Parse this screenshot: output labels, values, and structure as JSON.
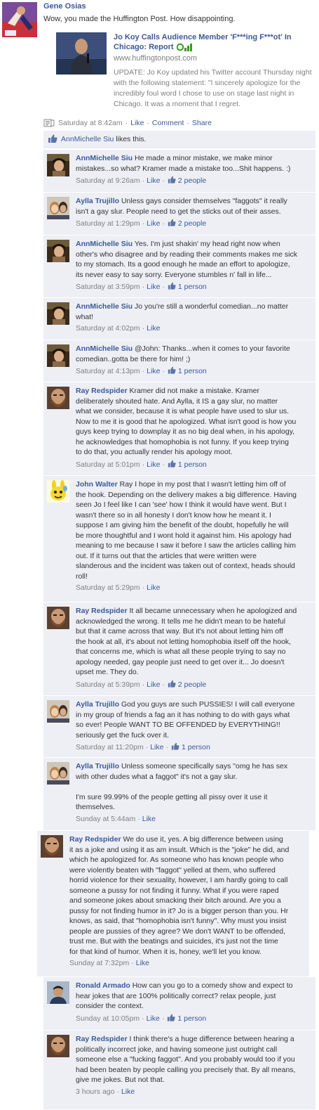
{
  "post": {
    "author": "Gene Osias",
    "message": "Wow, you made the Huffington Post. How disappointing.",
    "attachment": {
      "title_lines": [
        "Jo Koy Calls Audience Member 'F***ing F***ot' In",
        "Chicago: Report"
      ],
      "url": "www.huffingtonpost.com",
      "description_lines": [
        "UPDATE: Jo Koy updated his Twitter account Thursday night",
        "with the following statement: \"I sincerely apologize for the",
        "incredibly foul word I chose to use on stage last night in",
        "Chicago. It was a moment that I regret."
      ]
    },
    "meta": {
      "timestamp": "Saturday at 8:42am",
      "like": "Like",
      "comment": "Comment",
      "share": "Share"
    },
    "likes": {
      "who": "AnnMichelle Siu",
      "rest": "likes this."
    }
  },
  "comments": [
    {
      "name": "AnnMichelle Siu",
      "lines": [
        "He made a minor mistake, we make minor",
        "mistakes...so what? Kramer made a mistake too...Shit happens. :)"
      ],
      "time": "Saturday at 9:26am",
      "like": "Like",
      "likes_count": "2 people"
    },
    {
      "name": "Aylla Trujillo",
      "lines": [
        "Unless gays consider themselves \"faggots\" it really",
        "isn't a gay slur. People need to get the sticks out of their asses."
      ],
      "time": "Saturday at 1:29pm",
      "like": "Like",
      "likes_count": "2 people"
    },
    {
      "name": "AnnMichelle Siu",
      "lines": [
        "Yes. I'm just shakin' my head right now when",
        "other's who disagree and by reading their comments makes me sick",
        "to my stomach. Its a good enough he made an effort to apologize,",
        "its never easy to say sorry. Everyone stumbles n' fall in life..."
      ],
      "time": "Saturday at 3:59pm",
      "like": "Like",
      "likes_count": "1 person"
    },
    {
      "name": "AnnMichelle Siu",
      "lines": [
        "Jo you're still a wonderful comedian...no matter",
        "what!"
      ],
      "time": "Saturday at 4:02pm",
      "like": "Like",
      "likes_count": ""
    },
    {
      "name": "AnnMichelle Siu",
      "lines": [
        "@John: Thanks...when it comes to your favorite",
        "comedian..gotta be there for him! ;)"
      ],
      "time": "Saturday at 4:13pm",
      "like": "Like",
      "likes_count": "1 person"
    },
    {
      "name": "Ray Redspider",
      "lines": [
        "Kramer did not make a mistake. Kramer",
        "deliberately shouted hate. And Aylla, it IS a gay slur, no matter",
        "what we consider, because it is what people have used to slur us.",
        "Now to me it is good that he apologized. What isn't good is how you",
        "guys keep trying to downplay it as no big deal when, in his apology,",
        "he acknowledges that homophobia is not funny. If you keep trying",
        "to do that, you actually render his apology moot."
      ],
      "time": "Saturday at 5:01pm",
      "like": "Like",
      "likes_count": "1 person"
    },
    {
      "name": "John Walter",
      "lines": [
        "Ray I hope in my post that I wasn't letting him off of",
        "the hook. Depending on the delivery makes a big difference. Having",
        "seen Jo I feel like I can 'see' how I think it would have went. But I",
        "wasn't there so in all honesty I don't know how he meant it. I",
        "suppose I am giving him the benefit of the doubt, hopefully he will",
        "be more thoughtful and I wont hold it against him. His apology had",
        "meaning to me because I saw it before I saw the articles calling him",
        "out. If it turns out that the articles that were written were",
        "slanderous and the incident was taken out of context, heads should",
        "roll!"
      ],
      "time": "Saturday at 5:29pm",
      "like": "Like",
      "likes_count": ""
    },
    {
      "name": "Ray Redspider",
      "lines": [
        "It all became unnecessary when he apologized and",
        "acknowledged the wrong. It tells me he didn't mean to be hateful",
        "but that it came across that way. But it's not about letting him off",
        "the hook at all, it's about not letting homophobia itself off the hook,",
        "that concerns me, which is what all these people trying to say no",
        "apology needed, gay people just need to get over it... Jo doesn't",
        "upset me. They do."
      ],
      "time": "Saturday at 5:39pm",
      "like": "Like",
      "likes_count": "2 people"
    },
    {
      "name": "Aylla Trujillo",
      "lines": [
        "God you guys are such PUSSIES! I will call everyone",
        "in my group of friends a fag an it has nothing to do with gays what",
        "so ever! People WANT TO BE OFFENDED by EVERYTHING!!",
        "seriously get the fuck over it."
      ],
      "time": "Saturday at 11:20pm",
      "like": "Like",
      "likes_count": "1 person"
    },
    {
      "name": "Aylla Trujillo",
      "lines": [
        "Unless someone specifically says \"omg he has sex",
        "with other dudes what a faggot\" it's not a gay slur.",
        "",
        "I'm sure 99.99% of the people getting all pissy over it use it",
        "themselves."
      ],
      "time": "Sunday at 5:44am",
      "like": "Like",
      "likes_count": ""
    },
    {
      "name": "Ray Redspider",
      "lines": [
        "We do use it, yes. A big difference between using",
        "it as a joke and using it as am insult. Which is the \"joke\" he did, and",
        "which he apologized for. As someone who has known people who",
        "were violently beaten with \"faggot\" yelled at them, who suffered",
        "horrid violence for their sexuality, however, I am hardly going to call",
        "someone a pussy for not finding it funny. What if you were raped",
        "and someone jokes about smacking their bitch around. Are you a",
        "pussy for not finding humor in it? Jo is a bigger person than you. Hr",
        "knows, as said, that \"homophobia isn't funny\". Why must you insist",
        "people are pussies of they agree? We don't WANT to be offended,",
        "trust me. But with the beatings and suicides, it's just not the time",
        "for that kind of humor. When it is, honey, we'll let you know."
      ],
      "time": "Sunday at 7:32pm",
      "like": "Like",
      "likes_count": ""
    },
    {
      "name": "Ronald Armado",
      "lines": [
        "How can you go to a comedy show and expect to",
        "hear jokes that are 100% politically correct? relax people, just",
        "consider the context."
      ],
      "time": "Sunday at 10:05pm",
      "like": "Like",
      "likes_count": "1 person"
    },
    {
      "name": "Ray Redspider",
      "lines": [
        "I think there's a huge difference between hearing a",
        "politically incorrect joke, and having someone just outright call",
        "someone else a \"fucking faggot\". And you probably would too if you",
        "had been beaten by people calling you precisely that. By all means,",
        "give me jokes. But not that."
      ],
      "time": "3 hours ago",
      "like": "Like",
      "likes_count": ""
    }
  ]
}
